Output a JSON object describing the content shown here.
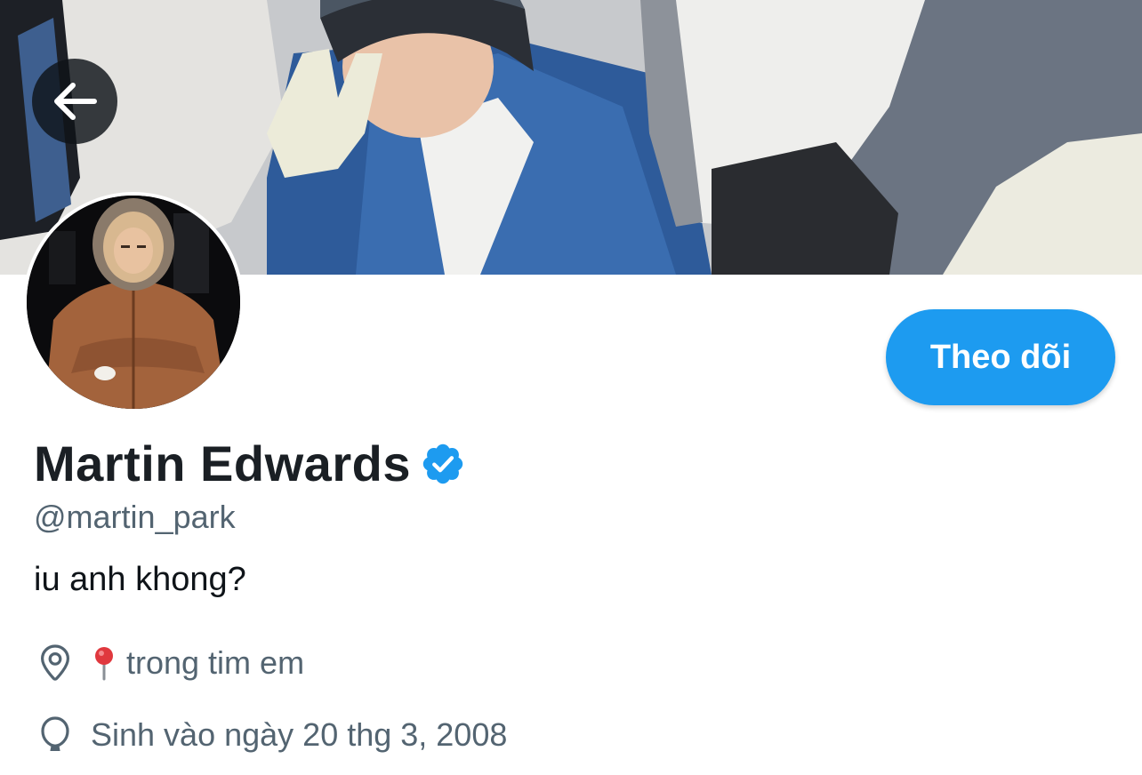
{
  "header": {
    "back_icon": "arrow-left-icon"
  },
  "profile": {
    "display_name": "Martin Edwards",
    "verified_icon": "verified-badge-icon",
    "handle": "@martin_park",
    "bio": "iu anh khong?",
    "follow_label": "Theo dõi",
    "location_icon": "location-pin-icon",
    "location_emoji": "round-pushpin-emoji",
    "location": "trong tim em",
    "birthday_icon": "balloon-icon",
    "birthday": "Sinh vào ngày 20 thg 3, 2008"
  },
  "colors": {
    "accent": "#1d9bf0",
    "secondary_text": "#536471",
    "primary_text": "#0f1419"
  }
}
